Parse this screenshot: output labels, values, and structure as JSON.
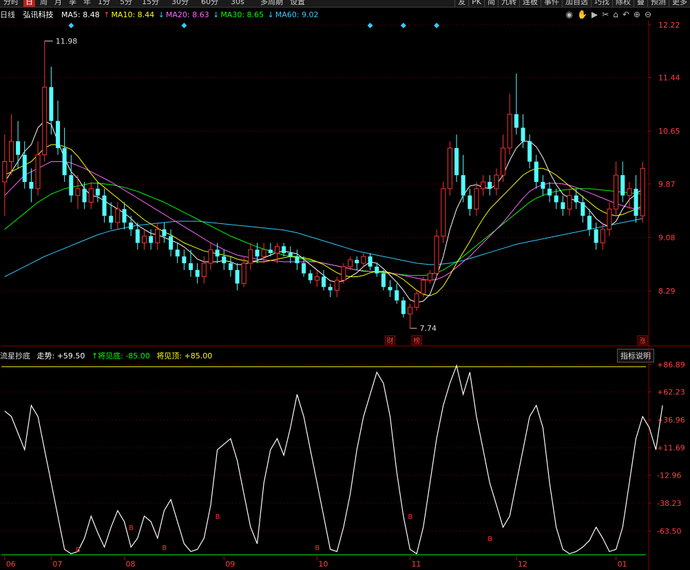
{
  "toolbar": {
    "tabs": [
      "分时",
      "日",
      "周",
      "月",
      "季",
      "年",
      "1分",
      "5分",
      "15分",
      "30分",
      "60分",
      "30s",
      "多周期",
      "设置"
    ],
    "active_tab": "日",
    "right": [
      "友",
      "PK",
      "简",
      "九转",
      "连板",
      "事件",
      "加自选",
      "巧找",
      "除权",
      "叠",
      "预测",
      "更多"
    ]
  },
  "header": {
    "period": "日线",
    "stock_name": "弘讯科技",
    "ma5": {
      "label": "MA5: 8.48",
      "color": "#ffffff"
    },
    "ma10": {
      "label": "MA10: 8.44",
      "arrow": "↑",
      "color": "#ffff00"
    },
    "ma20": {
      "label": "MA20: 8.63",
      "arrow": "↓",
      "color": "#ff66ff"
    },
    "ma30": {
      "label": "MA30: 8.65",
      "arrow": "↓",
      "color": "#00ff00"
    },
    "ma60": {
      "label": "MA60: 9.02",
      "arrow": "↓",
      "color": "#33ccff"
    }
  },
  "icons": [
    "eye-icon",
    "hand-icon",
    "play-icon",
    "scissors-icon",
    "lock-icon",
    "back-icon",
    "zoom-in-icon",
    "zoom-out-icon"
  ],
  "indicator": {
    "name": "流星抄底",
    "trend": "走势: +59.50",
    "bottom": "↑将见底: -85.00",
    "top": "将见顶: +85.00",
    "explain_button": "指标说明"
  },
  "chart_data": [
    {
      "type": "candlestick",
      "title": "弘讯科技 日线",
      "y_ticks": [
        "12.22",
        "11.44",
        "10.65",
        "9.87",
        "9.08",
        "8.29"
      ],
      "ylim": [
        7.6,
        12.25
      ],
      "high_label": "11.98",
      "low_label": "7.74",
      "markers": [
        "财",
        "榜",
        "涨"
      ],
      "colors": {
        "up": "#ff3232",
        "down": "#54ffff",
        "ma5": "#ffffff",
        "ma10": "#ffff00",
        "ma20": "#ff66ff",
        "ma30": "#00ff00",
        "ma60": "#33ccff"
      },
      "ohlc": [
        [
          9.9,
          10.6,
          9.4,
          10.2
        ],
        [
          10.2,
          10.9,
          10.0,
          10.5
        ],
        [
          10.5,
          10.8,
          10.1,
          10.3
        ],
        [
          10.3,
          10.5,
          9.8,
          9.9
        ],
        [
          9.9,
          10.1,
          9.6,
          9.8
        ],
        [
          9.8,
          10.5,
          9.7,
          10.3
        ],
        [
          10.3,
          11.98,
          10.2,
          11.3
        ],
        [
          11.3,
          11.6,
          10.6,
          10.8
        ],
        [
          10.8,
          11.1,
          10.3,
          10.4
        ],
        [
          10.4,
          10.7,
          9.9,
          10.0
        ],
        [
          10.0,
          10.3,
          9.6,
          9.7
        ],
        [
          9.7,
          10.0,
          9.5,
          9.8
        ],
        [
          9.8,
          9.9,
          9.5,
          9.6
        ],
        [
          9.6,
          9.9,
          9.5,
          9.8
        ],
        [
          9.8,
          9.9,
          9.6,
          9.7
        ],
        [
          9.7,
          9.8,
          9.3,
          9.4
        ],
        [
          9.4,
          9.6,
          9.2,
          9.3
        ],
        [
          9.3,
          9.6,
          9.2,
          9.5
        ],
        [
          9.5,
          9.6,
          9.2,
          9.3
        ],
        [
          9.3,
          9.4,
          9.1,
          9.2
        ],
        [
          9.2,
          9.3,
          8.9,
          9.0
        ],
        [
          9.0,
          9.2,
          8.9,
          9.1
        ],
        [
          9.1,
          9.2,
          8.9,
          9.0
        ],
        [
          9.0,
          9.3,
          8.9,
          9.2
        ],
        [
          9.2,
          9.3,
          9.0,
          9.1
        ],
        [
          9.1,
          9.2,
          8.8,
          8.9
        ],
        [
          8.9,
          9.0,
          8.7,
          8.8
        ],
        [
          8.8,
          8.9,
          8.6,
          8.7
        ],
        [
          8.7,
          8.9,
          8.5,
          8.6
        ],
        [
          8.6,
          8.7,
          8.4,
          8.5
        ],
        [
          8.5,
          8.8,
          8.4,
          8.7
        ],
        [
          8.7,
          9.0,
          8.6,
          8.9
        ],
        [
          8.9,
          9.0,
          8.7,
          8.8
        ],
        [
          8.8,
          8.9,
          8.6,
          8.7
        ],
        [
          8.7,
          8.8,
          8.5,
          8.6
        ],
        [
          8.6,
          8.7,
          8.3,
          8.4
        ],
        [
          8.4,
          8.8,
          8.35,
          8.7
        ],
        [
          8.7,
          9.0,
          8.6,
          8.9
        ],
        [
          8.9,
          9.0,
          8.7,
          8.8
        ],
        [
          8.8,
          9.0,
          8.7,
          8.9
        ],
        [
          8.9,
          9.0,
          8.8,
          8.85
        ],
        [
          8.85,
          9.0,
          8.7,
          8.95
        ],
        [
          8.95,
          9.0,
          8.8,
          8.85
        ],
        [
          8.85,
          8.95,
          8.7,
          8.8
        ],
        [
          8.8,
          8.9,
          8.6,
          8.7
        ],
        [
          8.7,
          8.8,
          8.5,
          8.55
        ],
        [
          8.55,
          8.6,
          8.4,
          8.45
        ],
        [
          8.45,
          8.6,
          8.35,
          8.5
        ],
        [
          8.5,
          8.6,
          8.3,
          8.35
        ],
        [
          8.35,
          8.4,
          8.2,
          8.3
        ],
        [
          8.3,
          8.5,
          8.2,
          8.45
        ],
        [
          8.45,
          8.7,
          8.4,
          8.65
        ],
        [
          8.65,
          8.8,
          8.6,
          8.75
        ],
        [
          8.75,
          8.8,
          8.6,
          8.7
        ],
        [
          8.7,
          8.85,
          8.65,
          8.8
        ],
        [
          8.8,
          8.85,
          8.6,
          8.65
        ],
        [
          8.65,
          8.7,
          8.5,
          8.55
        ],
        [
          8.55,
          8.6,
          8.3,
          8.35
        ],
        [
          8.35,
          8.45,
          8.2,
          8.3
        ],
        [
          8.3,
          8.4,
          8.1,
          8.15
        ],
        [
          8.15,
          8.2,
          7.9,
          7.95
        ],
        [
          7.95,
          8.1,
          7.74,
          8.05
        ],
        [
          8.05,
          8.3,
          8.0,
          8.25
        ],
        [
          8.25,
          8.5,
          8.2,
          8.45
        ],
        [
          8.45,
          8.6,
          8.4,
          8.55
        ],
        [
          8.55,
          9.2,
          8.5,
          9.1
        ],
        [
          9.1,
          9.9,
          9.0,
          9.8
        ],
        [
          9.8,
          10.5,
          9.7,
          10.4
        ],
        [
          10.4,
          10.6,
          9.9,
          10.0
        ],
        [
          10.0,
          10.3,
          9.6,
          9.7
        ],
        [
          9.7,
          9.8,
          9.4,
          9.5
        ],
        [
          9.5,
          9.9,
          9.4,
          9.8
        ],
        [
          9.8,
          10.0,
          9.7,
          9.9
        ],
        [
          9.9,
          10.0,
          9.7,
          9.8
        ],
        [
          9.8,
          10.1,
          9.7,
          10.0
        ],
        [
          10.0,
          10.6,
          9.9,
          10.4
        ],
        [
          10.4,
          11.2,
          10.3,
          10.9
        ],
        [
          10.9,
          11.5,
          10.6,
          10.7
        ],
        [
          10.7,
          10.9,
          10.4,
          10.5
        ],
        [
          10.5,
          10.6,
          10.1,
          10.2
        ],
        [
          10.2,
          10.3,
          9.8,
          9.9
        ],
        [
          9.9,
          10.0,
          9.7,
          9.8
        ],
        [
          9.8,
          9.9,
          9.6,
          9.7
        ],
        [
          9.7,
          9.8,
          9.5,
          9.6
        ],
        [
          9.6,
          9.7,
          9.4,
          9.5
        ],
        [
          9.5,
          9.8,
          9.4,
          9.7
        ],
        [
          9.7,
          9.8,
          9.5,
          9.6
        ],
        [
          9.6,
          9.7,
          9.3,
          9.4
        ],
        [
          9.4,
          9.5,
          9.1,
          9.2
        ],
        [
          9.2,
          9.3,
          8.9,
          9.0
        ],
        [
          9.0,
          9.3,
          8.9,
          9.2
        ],
        [
          9.2,
          9.6,
          9.1,
          9.5
        ],
        [
          9.5,
          10.2,
          9.4,
          10.0
        ],
        [
          10.0,
          10.2,
          9.6,
          9.7
        ],
        [
          9.7,
          9.9,
          9.5,
          9.8
        ],
        [
          9.8,
          10.0,
          9.3,
          9.4
        ],
        [
          9.4,
          10.2,
          9.3,
          10.1
        ]
      ],
      "ma5": [
        9.9,
        10.05,
        10.2,
        10.35,
        10.45,
        10.7,
        10.8,
        10.75,
        10.5,
        10.25,
        10.05,
        9.95,
        9.8,
        9.7,
        9.68,
        9.62,
        9.56,
        9.5,
        9.44,
        9.36,
        9.26,
        9.2,
        9.14,
        9.12,
        9.08,
        9.04,
        9.0,
        8.94,
        8.86,
        8.76,
        8.72,
        8.72,
        8.72,
        8.74,
        8.72,
        8.68,
        8.68,
        8.72,
        8.74,
        8.78,
        8.82,
        8.86,
        8.88,
        8.86,
        8.84,
        8.76,
        8.68,
        8.6,
        8.52,
        8.44,
        8.42,
        8.44,
        8.5,
        8.56,
        8.65,
        8.72,
        8.7,
        8.62,
        8.52,
        8.42,
        8.3,
        8.16,
        8.12,
        8.14,
        8.24,
        8.5,
        8.8,
        9.2,
        9.5,
        9.7,
        9.84,
        9.86,
        9.82,
        9.8,
        9.86,
        10.0,
        10.22,
        10.4,
        10.5,
        10.5,
        10.42,
        10.26,
        10.04,
        9.86,
        9.72,
        9.66,
        9.62,
        9.58,
        9.48,
        9.36,
        9.28,
        9.24,
        9.32,
        9.5,
        9.64,
        9.72,
        9.8
      ],
      "ma10": [
        10.0,
        10.05,
        10.1,
        10.15,
        10.2,
        10.3,
        10.4,
        10.45,
        10.45,
        10.42,
        10.38,
        10.28,
        10.15,
        10.02,
        9.9,
        9.82,
        9.74,
        9.66,
        9.58,
        9.5,
        9.42,
        9.34,
        9.28,
        9.22,
        9.16,
        9.12,
        9.06,
        9.0,
        8.96,
        8.92,
        8.88,
        8.86,
        8.84,
        8.82,
        8.8,
        8.76,
        8.74,
        8.72,
        8.72,
        8.72,
        8.74,
        8.76,
        8.78,
        8.8,
        8.8,
        8.78,
        8.76,
        8.72,
        8.68,
        8.62,
        8.56,
        8.52,
        8.5,
        8.5,
        8.52,
        8.56,
        8.58,
        8.58,
        8.56,
        8.52,
        8.46,
        8.38,
        8.3,
        8.24,
        8.22,
        8.26,
        8.36,
        8.52,
        8.7,
        8.86,
        9.02,
        9.2,
        9.36,
        9.5,
        9.6,
        9.7,
        9.8,
        9.9,
        10.0,
        10.06,
        10.1,
        10.1,
        10.06,
        10.0,
        9.92,
        9.84,
        9.76,
        9.68,
        9.6,
        9.52,
        9.46,
        9.42,
        9.4,
        9.42,
        9.46,
        9.5,
        9.55
      ],
      "ma20": [
        9.7,
        9.8,
        9.9,
        10.0,
        10.05,
        10.1,
        10.15,
        10.2,
        10.2,
        10.2,
        10.18,
        10.14,
        10.1,
        10.05,
        10.0,
        9.95,
        9.9,
        9.84,
        9.78,
        9.72,
        9.66,
        9.6,
        9.54,
        9.48,
        9.42,
        9.36,
        9.3,
        9.24,
        9.18,
        9.12,
        9.06,
        9.0,
        8.95,
        8.9,
        8.86,
        8.82,
        8.8,
        8.78,
        8.76,
        8.75,
        8.74,
        8.73,
        8.72,
        8.72,
        8.72,
        8.72,
        8.72,
        8.72,
        8.7,
        8.68,
        8.66,
        8.64,
        8.62,
        8.6,
        8.58,
        8.58,
        8.58,
        8.57,
        8.56,
        8.54,
        8.52,
        8.5,
        8.48,
        8.46,
        8.45,
        8.46,
        8.5,
        8.56,
        8.64,
        8.72,
        8.8,
        8.9,
        9.0,
        9.1,
        9.2,
        9.3,
        9.42,
        9.54,
        9.66,
        9.76,
        9.82,
        9.86,
        9.88,
        9.88,
        9.87,
        9.85,
        9.82,
        9.78,
        9.74,
        9.7,
        9.66,
        9.62,
        9.58,
        9.55,
        9.52,
        9.5,
        9.5
      ],
      "ma30": [
        9.2,
        9.28,
        9.36,
        9.44,
        9.52,
        9.6,
        9.66,
        9.72,
        9.76,
        9.8,
        9.82,
        9.84,
        9.86,
        9.88,
        9.88,
        9.87,
        9.86,
        9.84,
        9.82,
        9.79,
        9.76,
        9.72,
        9.68,
        9.64,
        9.6,
        9.55,
        9.5,
        9.45,
        9.4,
        9.35,
        9.3,
        9.25,
        9.2,
        9.15,
        9.1,
        9.06,
        9.02,
        8.98,
        8.94,
        8.91,
        8.88,
        8.85,
        8.82,
        8.8,
        8.78,
        8.76,
        8.74,
        8.72,
        8.7,
        8.68,
        8.66,
        8.64,
        8.62,
        8.6,
        8.59,
        8.58,
        8.57,
        8.56,
        8.55,
        8.54,
        8.53,
        8.52,
        8.52,
        8.52,
        8.53,
        8.56,
        8.6,
        8.66,
        8.72,
        8.8,
        8.88,
        8.96,
        9.04,
        9.12,
        9.2,
        9.28,
        9.36,
        9.44,
        9.52,
        9.6,
        9.66,
        9.7,
        9.74,
        9.76,
        9.78,
        9.79,
        9.8,
        9.8,
        9.8,
        9.79,
        9.78,
        9.77,
        9.76,
        9.75,
        9.74,
        9.73,
        9.72
      ],
      "ma60": [
        8.5,
        8.55,
        8.6,
        8.65,
        8.7,
        8.75,
        8.8,
        8.84,
        8.88,
        8.92,
        8.96,
        9.0,
        9.04,
        9.08,
        9.12,
        9.15,
        9.18,
        9.2,
        9.22,
        9.24,
        9.26,
        9.27,
        9.28,
        9.29,
        9.3,
        9.31,
        9.32,
        9.32,
        9.32,
        9.32,
        9.31,
        9.3,
        9.29,
        9.28,
        9.27,
        9.26,
        9.25,
        9.24,
        9.23,
        9.22,
        9.21,
        9.2,
        9.19,
        9.17,
        9.15,
        9.12,
        9.09,
        9.06,
        9.03,
        9.0,
        8.97,
        8.94,
        8.91,
        8.88,
        8.86,
        8.84,
        8.82,
        8.8,
        8.78,
        8.76,
        8.74,
        8.72,
        8.7,
        8.69,
        8.68,
        8.68,
        8.69,
        8.7,
        8.72,
        8.74,
        8.77,
        8.8,
        8.83,
        8.86,
        8.89,
        8.92,
        8.95,
        8.98,
        9.0,
        9.02,
        9.04,
        9.06,
        9.08,
        9.1,
        9.12,
        9.14,
        9.16,
        9.18,
        9.2,
        9.22,
        9.24,
        9.26,
        9.28,
        9.3,
        9.32,
        9.34,
        9.36
      ]
    },
    {
      "type": "line",
      "title": "流星抄底",
      "y_ticks": [
        "+86.89",
        "+62.23",
        "+36.96",
        "+11.69",
        "-12.96",
        "-38.23",
        "-63.50"
      ],
      "ylim": [
        -85,
        90
      ],
      "top_line": 85,
      "bottom_line": -85,
      "x_labels": [
        "06",
        "07",
        "08",
        "09",
        "10",
        "11",
        "12",
        "01"
      ],
      "buy_markers": [
        [
          11,
          -80
        ],
        [
          19,
          -60
        ],
        [
          24,
          -78
        ],
        [
          32,
          -50
        ],
        [
          47,
          -78
        ],
        [
          61,
          -50
        ],
        [
          73,
          -70
        ]
      ],
      "buy_label": "B",
      "values": [
        45,
        40,
        25,
        10,
        50,
        40,
        10,
        -20,
        -50,
        -80,
        -84,
        -82,
        -70,
        -50,
        -65,
        -78,
        -60,
        -45,
        -55,
        -78,
        -70,
        -50,
        -55,
        -70,
        -45,
        -35,
        -55,
        -75,
        -82,
        -80,
        -70,
        -40,
        10,
        15,
        20,
        0,
        -30,
        -60,
        -75,
        -20,
        10,
        20,
        5,
        30,
        60,
        40,
        10,
        -20,
        -50,
        -80,
        -82,
        -60,
        -30,
        10,
        40,
        60,
        80,
        70,
        40,
        -10,
        -50,
        -80,
        -84,
        -60,
        -20,
        20,
        50,
        70,
        86,
        60,
        80,
        40,
        10,
        -20,
        -40,
        -60,
        -50,
        -20,
        10,
        40,
        50,
        30,
        -20,
        -60,
        -80,
        -84,
        -82,
        -78,
        -72,
        -60,
        -70,
        -82,
        -80,
        -60,
        -20,
        20,
        40,
        30,
        10,
        50
      ]
    }
  ]
}
